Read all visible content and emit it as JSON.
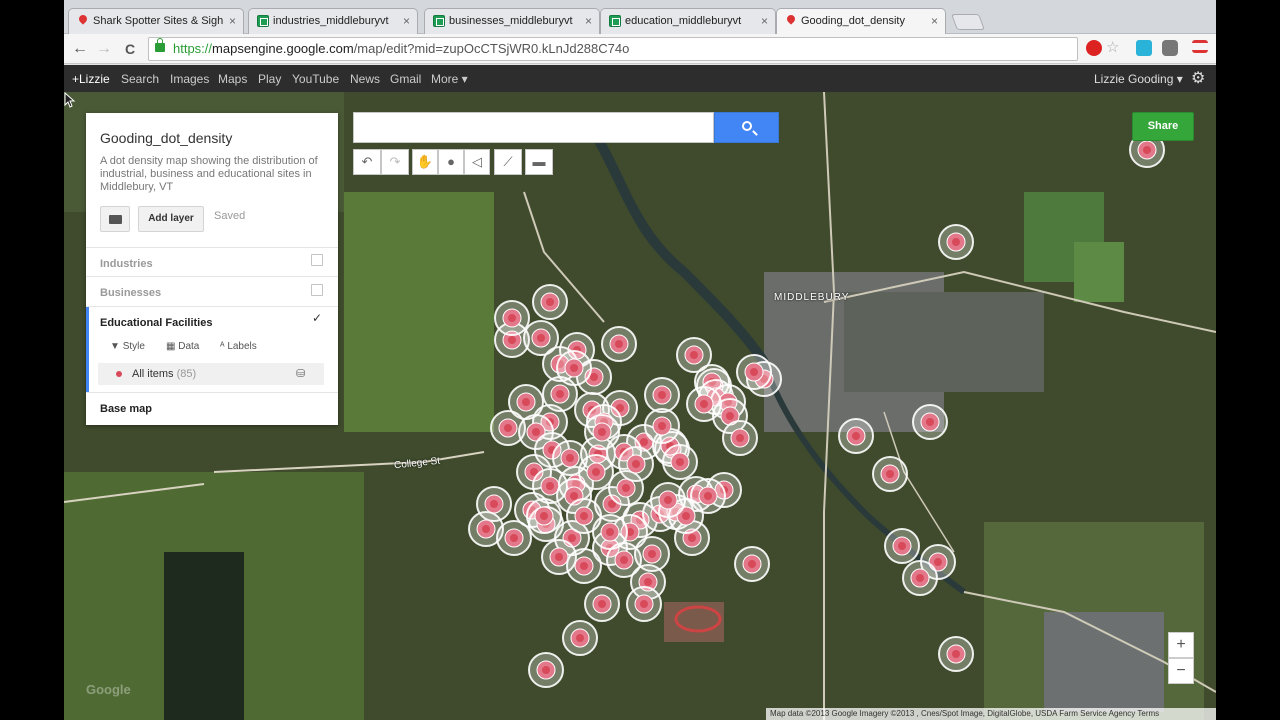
{
  "tabs": [
    {
      "title": "Shark Spotter Sites & Sigh",
      "icon": "map-pin-icon"
    },
    {
      "title": "industries_middleburyvt",
      "icon": "spreadsheet-icon"
    },
    {
      "title": "businesses_middleburyvt",
      "icon": "spreadsheet-icon"
    },
    {
      "title": "education_middleburyvt",
      "icon": "spreadsheet-icon"
    },
    {
      "title": "Gooding_dot_density",
      "icon": "map-pin-icon"
    }
  ],
  "tab_close": "×",
  "nav": {
    "back": "←",
    "forward": "→",
    "reload": "C"
  },
  "url": {
    "scheme": "https://",
    "domain": "mapsengine.google.com",
    "path": "/map/edit?mid=zupOcCTSjWR0.kLnJd288C74o"
  },
  "google_bar": {
    "items": [
      "+Lizzie",
      "Search",
      "Images",
      "Maps",
      "Play",
      "YouTube",
      "News",
      "Gmail",
      "More ▾"
    ],
    "user": "Lizzie Gooding ▾"
  },
  "search": {
    "placeholder": ""
  },
  "toolbar": {
    "undo": "↶",
    "redo": "↷",
    "line": "⟋",
    "measure": "▬"
  },
  "panel": {
    "title": "Gooding_dot_density",
    "description": "A dot density map showing the distribution of industrial, business and educational sites in Middlebury, VT",
    "add_layer": "Add layer",
    "saved": "Saved",
    "layers": [
      {
        "name": "Industries",
        "checked": false
      },
      {
        "name": "Businesses",
        "checked": false
      },
      {
        "name": "Educational Facilities",
        "checked": true
      }
    ],
    "sub_style": "Style",
    "sub_data": "Data",
    "sub_labels": "Labels",
    "all_items": "All items",
    "all_items_count": "(85)",
    "base_map": "Base map",
    "check_mark": "✓"
  },
  "share": "Share",
  "zoom": {
    "in": "+",
    "out": "−"
  },
  "attribution": "Map data ©2013 Google Imagery ©2013 , Cnes/Spot Image, DigitalGlobe, USDA Farm Service Agency  Terms",
  "watermark": "Google",
  "map_labels": {
    "town": "MIDDLEBURY",
    "street": "College St"
  },
  "colors": {
    "marker": "#e2788a",
    "marker_center": "#d84a5a",
    "accent": "#4285f4",
    "share": "#35a63a"
  }
}
